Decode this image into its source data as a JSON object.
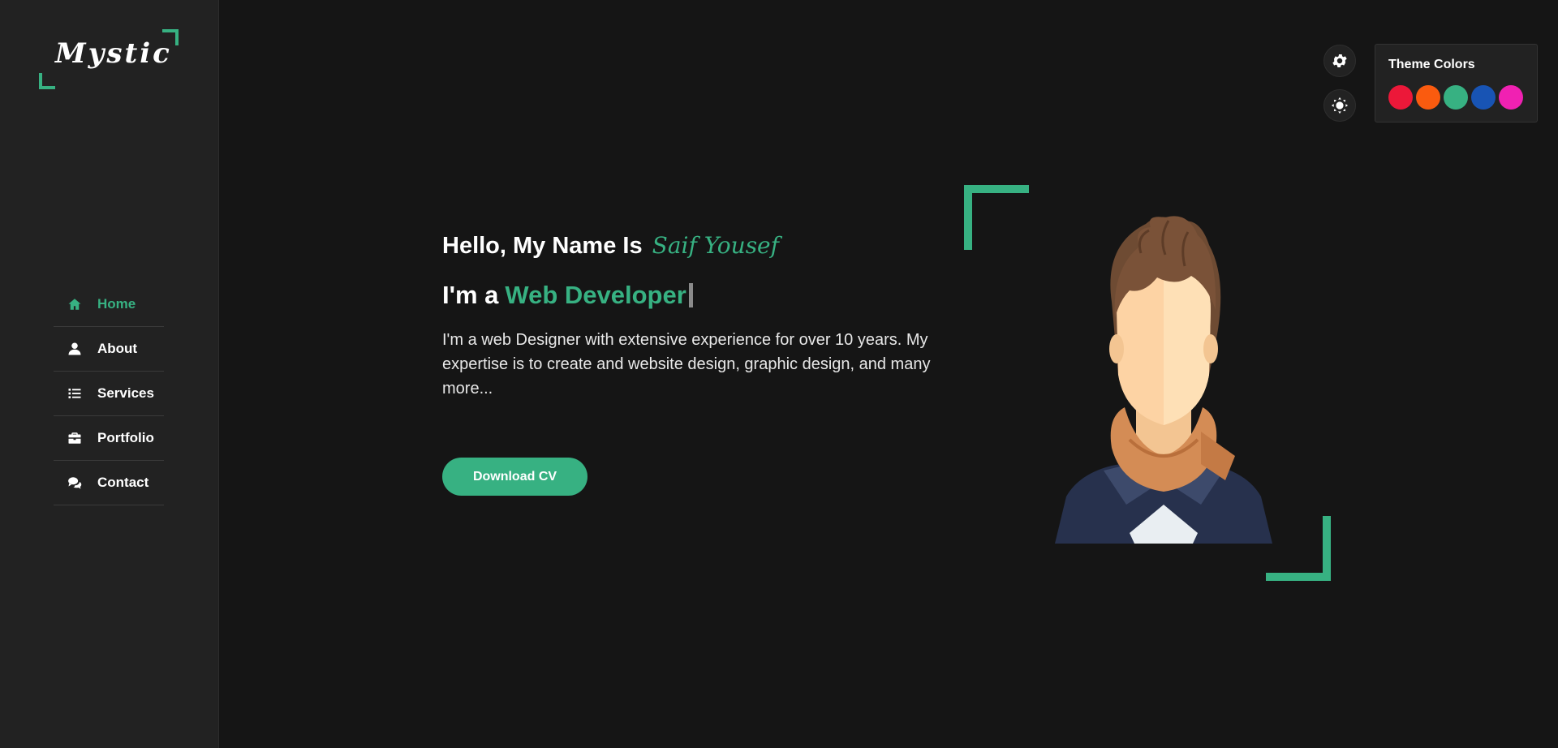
{
  "theme": {
    "accent": "#37b182",
    "background": "#151515",
    "sidebar_bg": "#222222"
  },
  "logo": {
    "text": "Mystic"
  },
  "nav": {
    "items": [
      {
        "label": "Home",
        "icon": "home-icon",
        "active": true
      },
      {
        "label": "About",
        "icon": "user-icon",
        "active": false
      },
      {
        "label": "Services",
        "icon": "list-icon",
        "active": false
      },
      {
        "label": "Portfolio",
        "icon": "briefcase-icon",
        "active": false
      },
      {
        "label": "Contact",
        "icon": "comments-icon",
        "active": false
      }
    ]
  },
  "hero": {
    "greeting": "Hello, My Name Is",
    "name": "Saif Yousef",
    "role_prefix": "I'm a",
    "role": "Web Developer",
    "description": "I'm a web Designer with extensive experience for over 10 years. My expertise is to create and website design, graphic design, and many more...",
    "cta_label": "Download CV"
  },
  "theme_panel": {
    "title": "Theme Colors",
    "colors": [
      "#ec1839",
      "#fa5b0f",
      "#37b182",
      "#1854b4",
      "#f021b2"
    ]
  }
}
